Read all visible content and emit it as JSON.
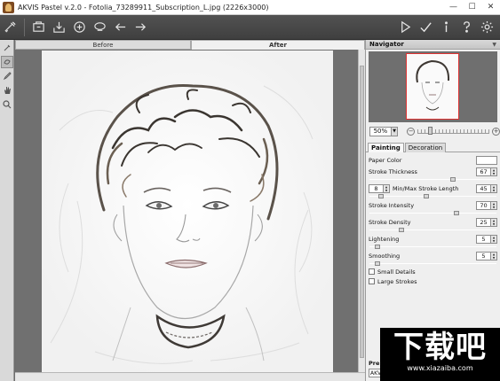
{
  "window": {
    "title": "AKVIS Pastel v.2.0 - Fotolia_73289911_Subscription_L.jpg (2226x3000)",
    "minimize": "—",
    "maximize": "☐",
    "close": "✕"
  },
  "toolbar": {
    "left_icons": [
      "logo-icon",
      "open-icon",
      "save-icon",
      "share-icon",
      "print-icon",
      "undo-icon",
      "redo-icon"
    ],
    "right_icons": [
      "run-icon",
      "apply-icon",
      "info-icon",
      "help-icon",
      "settings-icon"
    ]
  },
  "tools": [
    "brush-icon",
    "eraser-icon",
    "pencil-icon",
    "hand-icon",
    "zoom-icon"
  ],
  "view_tabs": {
    "before": "Before",
    "after": "After"
  },
  "navigator": {
    "title": "Navigator",
    "zoom_value": "50%"
  },
  "panel_tabs": {
    "painting": "Painting",
    "decoration": "Decoration"
  },
  "params": {
    "paper_color": {
      "label": "Paper Color",
      "color": "#ffffff"
    },
    "stroke_thickness": {
      "label": "Stroke Thickness",
      "value": "67",
      "level": 0.67
    },
    "stroke_length": {
      "label": "Min/Max Stroke Length",
      "min": "8",
      "max": "45",
      "level_min": 0.08,
      "level_max": 0.45
    },
    "stroke_intensity": {
      "label": "Stroke Intensity",
      "value": "70",
      "level": 0.7
    },
    "stroke_density": {
      "label": "Stroke Density",
      "value": "25",
      "level": 0.25
    },
    "lightening": {
      "label": "Lightening",
      "value": "5",
      "level": 0.05
    },
    "smoothing": {
      "label": "Smoothing",
      "value": "5",
      "level": 0.05
    },
    "small_details": {
      "label": "Small Details",
      "checked": false
    },
    "large_strokes": {
      "label": "Large Strokes",
      "checked": false
    }
  },
  "presets": {
    "label": "Pre",
    "value": "AKV"
  },
  "watermark": {
    "logo": "下载吧",
    "url": "www.xiazaiba.com"
  }
}
